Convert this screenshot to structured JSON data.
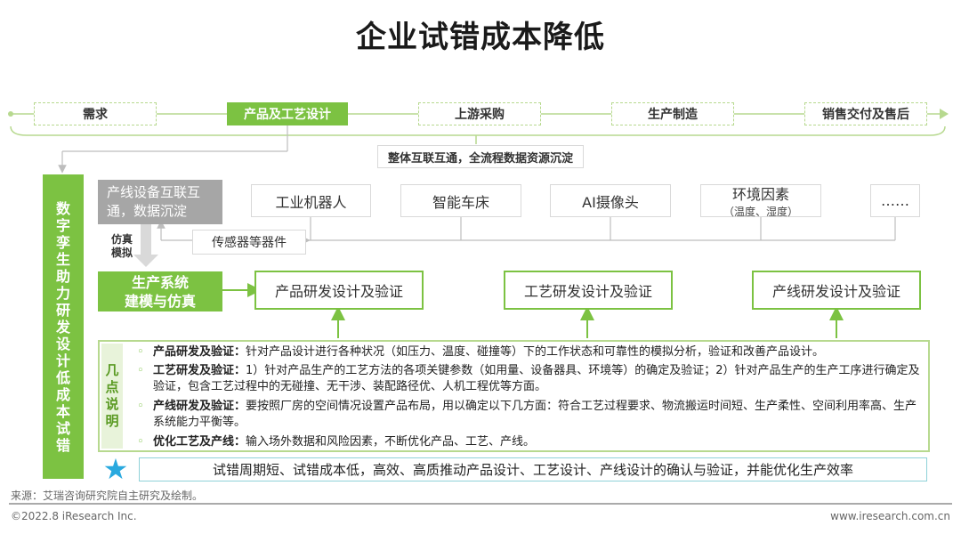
{
  "title": "企业试错成本降低",
  "stages": [
    {
      "label": "需求",
      "active": false
    },
    {
      "label": "产品及工艺设计",
      "active": true
    },
    {
      "label": "上游采购",
      "active": false
    },
    {
      "label": "生产制造",
      "active": false
    },
    {
      "label": "销售交付及售后",
      "active": false
    }
  ],
  "integration_note": "整体互联互通，全流程数据资源沉淀",
  "device_data": {
    "line1": "产线设备互联互",
    "line2": "通，数据沉淀"
  },
  "devices": [
    {
      "label": "工业机器人",
      "sub": ""
    },
    {
      "label": "智能车床",
      "sub": ""
    },
    {
      "label": "AI摄像头",
      "sub": ""
    },
    {
      "label": "环境因素",
      "sub": "（温度、湿度）"
    },
    {
      "label": "……",
      "sub": ""
    }
  ],
  "sensor": "传感器等器件",
  "simulation": {
    "line1": "仿真",
    "line2": "模拟"
  },
  "modeling": {
    "line1": "生产系统",
    "line2": "建模与仿真"
  },
  "verifications": [
    "产品研发设计及验证",
    "工艺研发设计及验证",
    "产线研发设计及验证"
  ],
  "side_label": [
    "数",
    "字",
    "孪",
    "生",
    "助",
    "力",
    "研",
    "发",
    "设",
    "计",
    "低",
    "成",
    "本",
    "试",
    "错"
  ],
  "notes_tag": [
    "几",
    "点",
    "说",
    "明"
  ],
  "notes": [
    {
      "head": "产品研发及验证：",
      "text": "针对产品设计进行各种状况（如压力、温度、碰撞等）下的工作状态和可靠性的模拟分析，验证和改善产品设计。"
    },
    {
      "head": "工艺研发及验证：",
      "text": "1）针对产品生产的工艺方法的各项关键参数（如用量、设备器具、环境等）的确定及验证；2）针对产品生产的生产工序进行确定及验证，包含工艺过程中的无碰撞、无干涉、装配路径优、人机工程优等方面。"
    },
    {
      "head": "产线研发及验证：",
      "text": "要按照厂房的空间情况设置产品布局，用以确定以下几方面：符合工艺过程要求、物流搬运时间短、生产柔性、空间利用率高、生产系统能力平衡等。"
    },
    {
      "head": "优化工艺及产线：",
      "text": "输入场外数据和风险因素，不断优化产品、工艺、产线。"
    }
  ],
  "note_bullet": "◦",
  "result": "试错周期短、试错成本低，高效、高质推动产品设计、工艺设计、产线设计的确认与验证，并能优化生产效率",
  "star": "★",
  "source": "来源：艾瑞咨询研究院自主研究及绘制。",
  "copyright": "©2022.8 iResearch Inc.",
  "website": "www.iresearch.com.cn",
  "colors": {
    "green": "#7cc242",
    "light_green": "#b7d98f",
    "gray": "#a6a6a6",
    "star": "#29a9df"
  }
}
